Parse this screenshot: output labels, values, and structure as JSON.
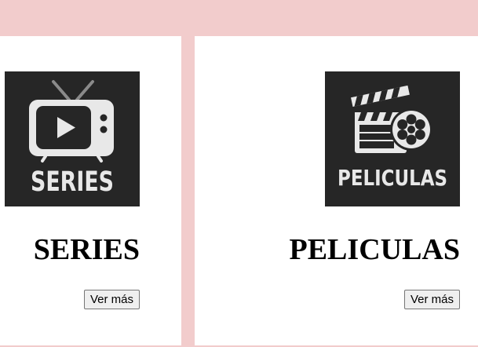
{
  "cards": [
    {
      "icon": "tv-series-icon",
      "icon_caption": "SERIES",
      "title": "SERIES",
      "button_label": "Ver más"
    },
    {
      "icon": "clapperboard-film-reel-icon",
      "icon_caption": "PELICULAS",
      "title": "PELICULAS",
      "button_label": "Ver más"
    }
  ],
  "colors": {
    "page_background": "#f2cccc",
    "card_background": "#ffffff",
    "icon_background": "#262626",
    "icon_foreground": "#e8e8e8"
  }
}
